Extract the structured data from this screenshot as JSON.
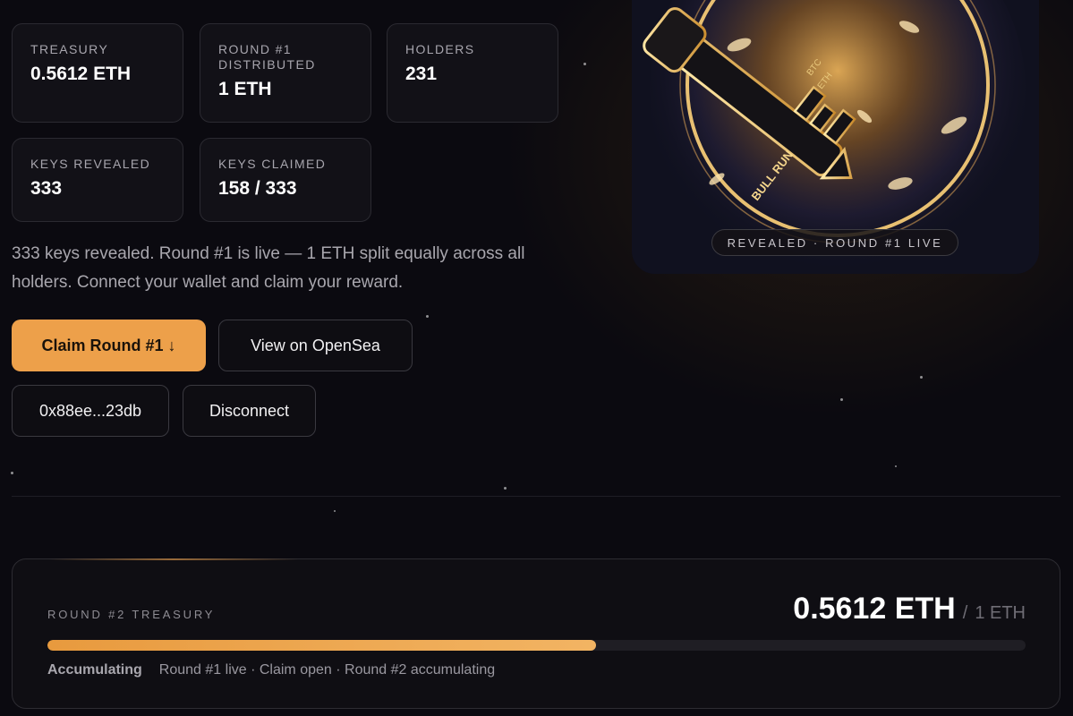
{
  "stats": [
    {
      "label": "TREASURY",
      "value": "0.5612 ETH"
    },
    {
      "label": "ROUND #1 DISTRIBUTED",
      "value": "1 ETH"
    },
    {
      "label": "HOLDERS",
      "value": "231"
    },
    {
      "label": "KEYS REVEALED",
      "value": "333"
    },
    {
      "label": "KEYS CLAIMED",
      "value": "158 / 333"
    }
  ],
  "description": "333 keys revealed. Round #1 is live — 1 ETH split equally across all holders. Connect your wallet and claim your reward.",
  "buttons": {
    "claim": "Claim Round #1 ↓",
    "opensea": "View on OpenSea",
    "wallet": "0x88ee...23db",
    "disconnect": "Disconnect"
  },
  "art": {
    "badge": "REVEALED · ROUND #1 LIVE",
    "key_text_top": "BTC",
    "key_text_mid": "ETH",
    "key_text_bit": "BULL RUN"
  },
  "round2": {
    "label": "ROUND #2 TREASURY",
    "value": "0.5612 ETH",
    "slash": "/",
    "total": "1 ETH",
    "progress_fraction": 0.5612,
    "status_strong": "Accumulating",
    "status_text": "Round #1 live · Claim open · Round #2 accumulating"
  },
  "colors": {
    "accent": "#eda04a",
    "background": "#0b0a10"
  }
}
